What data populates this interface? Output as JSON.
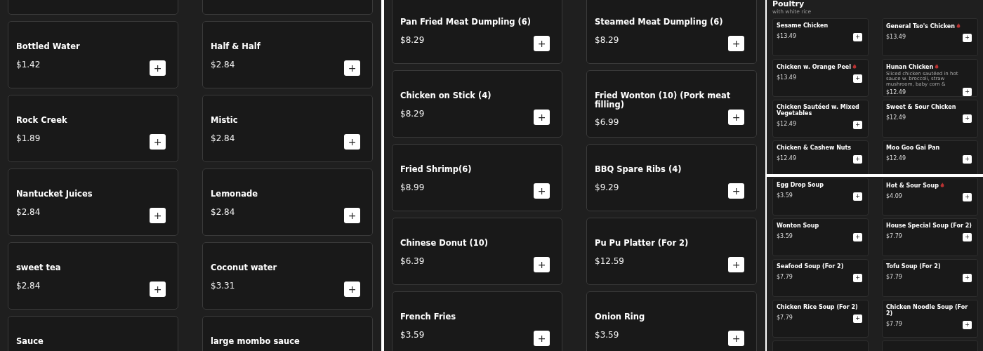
{
  "panels": [
    {
      "kind": "large",
      "items": [
        {
          "kind": "cut"
        },
        {
          "kind": "cut"
        },
        {
          "kind": "dish",
          "name": "Bottled Water",
          "spicy": false,
          "price": "$1.42",
          "add_button": "+"
        },
        {
          "kind": "dish",
          "name": "Half & Half",
          "spicy": false,
          "price": "$2.84",
          "add_button": "+"
        },
        {
          "kind": "dish",
          "name": "Rock Creek",
          "spicy": false,
          "price": "$1.89",
          "add_button": "+"
        },
        {
          "kind": "dish",
          "name": "Mistic",
          "spicy": false,
          "price": "$2.84",
          "add_button": "+"
        },
        {
          "kind": "dish",
          "name": "Nantucket Juices",
          "spicy": false,
          "price": "$2.84",
          "add_button": "+"
        },
        {
          "kind": "dish",
          "name": "Lemonade",
          "spicy": false,
          "price": "$2.84",
          "add_button": "+"
        },
        {
          "kind": "dish",
          "name": "sweet tea",
          "spicy": false,
          "price": "$2.84",
          "add_button": "+"
        },
        {
          "kind": "dish",
          "name": "Coconut water",
          "spicy": false,
          "price": "$3.31",
          "add_button": "+"
        },
        {
          "kind": "dish",
          "name": "Sauce",
          "spicy": false
        },
        {
          "kind": "dish",
          "name": "large mombo sauce",
          "spicy": false
        }
      ]
    },
    {
      "kind": "large",
      "items": [
        {
          "kind": "dish",
          "name": "Pan Fried Meat Dumpling (6)",
          "spicy": false,
          "price": "$8.29",
          "add_button": "+"
        },
        {
          "kind": "dish",
          "name": "Steamed Meat Dumpling (6)",
          "spicy": false,
          "price": "$8.29",
          "add_button": "+"
        },
        {
          "kind": "dish",
          "name": "Chicken on Stick (4)",
          "spicy": false,
          "price": "$8.29",
          "add_button": "+"
        },
        {
          "kind": "dish",
          "name": "Fried Wonton (10) (Pork meat filling)",
          "spicy": false,
          "price": "$6.99",
          "add_button": "+"
        },
        {
          "kind": "dish",
          "name": "Fried Shrimp(6)",
          "spicy": false,
          "price": "$8.99",
          "add_button": "+"
        },
        {
          "kind": "dish",
          "name": "BBQ Spare Ribs (4)",
          "spicy": false,
          "price": "$9.29",
          "add_button": "+"
        },
        {
          "kind": "dish",
          "name": "Chinese Donut (10)",
          "spicy": false,
          "price": "$6.39",
          "add_button": "+"
        },
        {
          "kind": "dish",
          "name": "Pu Pu Platter (For 2)",
          "spicy": false,
          "price": "$12.59",
          "add_button": "+"
        },
        {
          "kind": "dish",
          "name": "French Fries",
          "spicy": false,
          "price": "$3.59",
          "add_button": "+"
        },
        {
          "kind": "dish",
          "name": "Onion Ring",
          "spicy": false,
          "price": "$3.59",
          "add_button": "+"
        }
      ]
    },
    {
      "kind": "small",
      "title": "Poultry",
      "subtitle": "with white rice",
      "items": [
        {
          "kind": "dish",
          "name": "Sesame Chicken",
          "spicy": false,
          "price": "$13.49",
          "add_button": "+"
        },
        {
          "kind": "dish",
          "name": "General Tso's Chicken",
          "spicy": true,
          "price": "$13.49",
          "add_button": "+"
        },
        {
          "kind": "dish",
          "name": "Chicken w. Orange Peel",
          "spicy": true,
          "price": "$13.49",
          "add_button": "+"
        },
        {
          "kind": "dish",
          "name": "Hunan Chicken",
          "spicy": true,
          "description": "Sliced chicken sautéed in hot sauce w. broccoli, straw mushroom, baby corn &",
          "price": "$12.49",
          "add_button": "+"
        },
        {
          "kind": "dish",
          "name": "Chicken Sautéed w. Mixed Vegetables",
          "spicy": false,
          "price": "$12.49",
          "add_button": "+"
        },
        {
          "kind": "dish",
          "name": "Sweet & Sour Chicken",
          "spicy": false,
          "price": "$12.49",
          "add_button": "+"
        },
        {
          "kind": "dish",
          "name": "Chicken & Cashew Nuts",
          "spicy": false,
          "price": "$12.49",
          "add_button": "+"
        },
        {
          "kind": "dish",
          "name": "Moo Goo Gai Pan",
          "spicy": false,
          "price": "$12.49",
          "add_button": "+"
        }
      ]
    },
    {
      "kind": "small",
      "items": [
        {
          "kind": "dish",
          "name": "Egg Drop Soup",
          "spicy": false,
          "price": "$3.59",
          "add_button": "+"
        },
        {
          "kind": "dish",
          "name": "Hot & Sour Soup",
          "spicy": true,
          "price": "$4.09",
          "add_button": "+"
        },
        {
          "kind": "dish",
          "name": "Wonton Soup",
          "spicy": false,
          "price": "$3.59",
          "add_button": "+"
        },
        {
          "kind": "dish",
          "name": "House Special Soup (For 2)",
          "spicy": false,
          "price": "$7.79",
          "add_button": "+"
        },
        {
          "kind": "dish",
          "name": "Seafood Soup (For 2)",
          "spicy": false,
          "price": "$7.79",
          "add_button": "+"
        },
        {
          "kind": "dish",
          "name": "Tofu Soup (For 2)",
          "spicy": false,
          "price": "$7.79",
          "add_button": "+"
        },
        {
          "kind": "dish",
          "name": "Chicken Rice Soup (For 2)",
          "spicy": false,
          "price": "$7.79",
          "add_button": "+"
        },
        {
          "kind": "dish",
          "name": "Chicken Noodle Soup (For 2)",
          "spicy": false,
          "price": "$7.79",
          "add_button": "+"
        },
        {
          "kind": "cut"
        },
        {
          "kind": "cut"
        }
      ]
    }
  ]
}
